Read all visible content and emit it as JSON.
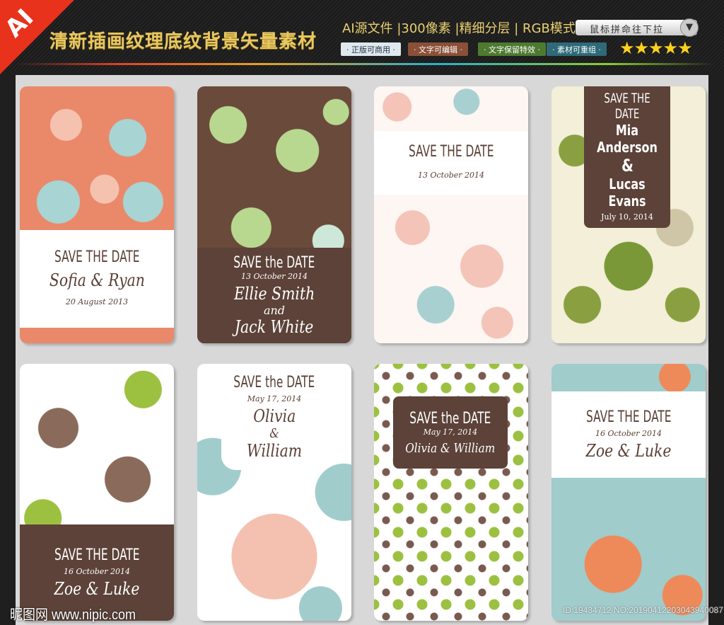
{
  "header": {
    "corner_badge": "AI",
    "title": "清新插画纹理底纹背景矢量素材",
    "specs": "AI源文件 |300像素 |精细分层 | RGB模式",
    "scroll_hint": "鼠标拼命往下拉",
    "scroll_icon": "chevron-down-icon",
    "tags": [
      {
        "label": "· 正版可商用 ·",
        "color": "#dfe8ee"
      },
      {
        "label": "· 文字可编辑 ·",
        "color": "#8a5038"
      },
      {
        "label": "· 文字保留特效 ·",
        "color": "#4e7a30"
      },
      {
        "label": "· 素材可重组 ·",
        "color": "#2e6a78"
      }
    ],
    "rating": 5,
    "stars": "★★★★★"
  },
  "cards": [
    {
      "save": "SAVE THE DATE",
      "names": "Sofia   &   Ryan",
      "date": "20 August 2013"
    },
    {
      "save": "SAVE the DATE",
      "date": "13 October 2014",
      "name1": "Ellie Smith",
      "and": "and",
      "name2": "Jack White"
    },
    {
      "save": "SAVE THE DATE",
      "date": "13 October 2014"
    },
    {
      "save": "SAVE THE DATE",
      "name1": "Mia Anderson",
      "amp": "&",
      "name2": "Lucas Evans",
      "date": "July 10, 2014"
    },
    {
      "save": "SAVE THE DATE",
      "date": "16 October 2014",
      "names": "Zoe  &  Luke"
    },
    {
      "save": "SAVE the DATE",
      "date": "May 17, 2014",
      "name1": "Olivia",
      "amp": "&",
      "name2": "William"
    },
    {
      "save": "SAVE the DATE",
      "date": "May 17, 2014",
      "names": "Olivia & William"
    },
    {
      "save": "SAVE THE DATE",
      "date": "16 October 2014",
      "names": "Zoe  &  Luke"
    }
  ],
  "footer": {
    "watermark": "昵图网 www.nipic.com",
    "id_text": "ID:19434712 NO:20190412203043940087"
  }
}
